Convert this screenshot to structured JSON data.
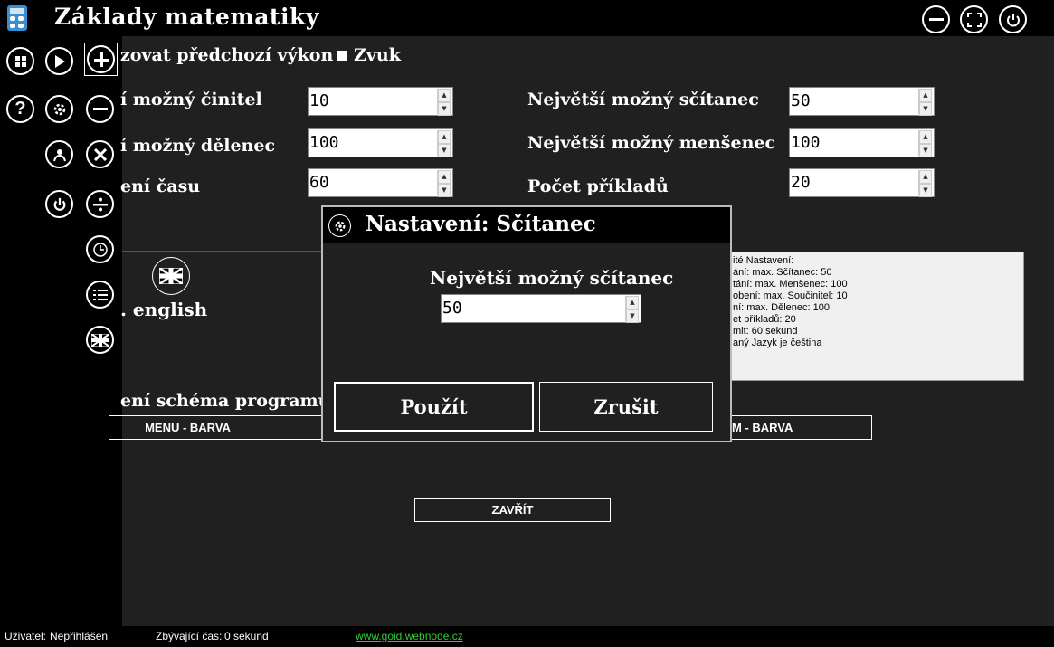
{
  "window": {
    "title": "Základy matematiky"
  },
  "header_controls": {
    "minimize": "minimize-icon",
    "fullscreen": "fullscreen-icon",
    "power": "power-icon"
  },
  "options": {
    "previous_performance": "zovat předchozí výkon",
    "sound_label": "Zvuk",
    "sound_checked": true
  },
  "settings": {
    "left": [
      {
        "label": "í možný činitel",
        "value": "10"
      },
      {
        "label": "í možný dělenec",
        "value": "100"
      },
      {
        "label": "ení času",
        "value": "60"
      }
    ],
    "right": [
      {
        "label": "Největší možný sčítanec",
        "value": "50"
      },
      {
        "label": "Největší možný menšenec",
        "value": "100"
      },
      {
        "label": "Počet příkladů",
        "value": "20"
      }
    ]
  },
  "language": {
    "label": ". english"
  },
  "summary": {
    "lines": [
      "ité Nastavení:",
      "ání: max. Sčítanec: 50",
      "tání: max. Menšenec: 100",
      "obení: max. Součinitel: 10",
      "ní: max. Dělenec: 100",
      "et příkladů: 20",
      "mit: 60 sekund",
      "aný Jazyk je čeština"
    ]
  },
  "scheme": {
    "heading": "ení schéma programu",
    "menu_color": "MENU - BARVA",
    "program_color": "M - BARVA"
  },
  "close_button": "ZAVŘÍT",
  "dialog": {
    "title": "Nastavení: Sčítanec",
    "field_label": "Největší možný sčítanec",
    "field_value": "50",
    "apply": "Použít",
    "cancel": "Zrušit"
  },
  "status": {
    "user_label": "Uživatel:",
    "user_value": "Nepřihlášen",
    "time_label": "Zbývající čas:",
    "time_value": "0 sekund",
    "link": "www.goid.webnode.cz"
  },
  "colors": {
    "background": "#202020",
    "bar": "#000000",
    "link": "#33cc33"
  }
}
